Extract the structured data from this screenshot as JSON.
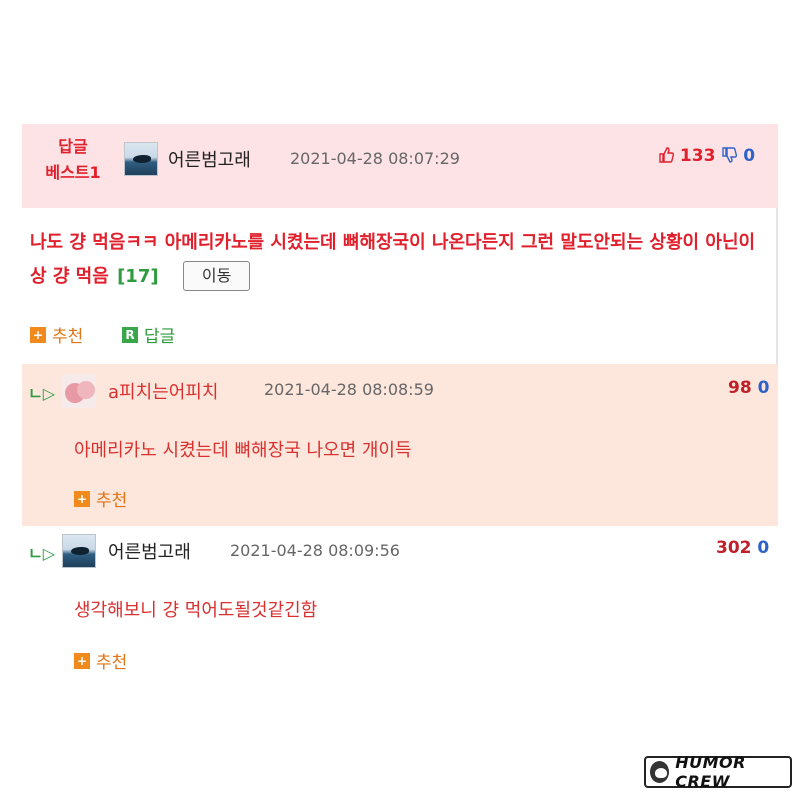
{
  "best": {
    "label_line1": "답글",
    "label_line2": "베스트1",
    "author": "어른범고래",
    "datetime": "2021-04-28 08:07:29",
    "upvotes": "133",
    "downvotes": "0",
    "body": "나도 걍 먹음ㅋㅋ 아메리카노를 시켰는데 뼈해장국이 나온다든지 그런 말도안되는 상황이 아닌이상 걍 먹음",
    "reply_count": "[17]",
    "move_label": "이동",
    "recommend_label": "추천",
    "reply_label": "답글"
  },
  "replies": [
    {
      "author": "a피치는어피치",
      "datetime": "2021-04-28 08:08:59",
      "upvotes": "98",
      "downvotes": "0",
      "body": "아메리카노 시켰는데 뼈해장국 나오면 개이득",
      "recommend_label": "추천"
    },
    {
      "author": "어른범고래",
      "datetime": "2021-04-28 08:09:56",
      "upvotes": "302",
      "downvotes": "0",
      "body": "생각해보니 걍 먹어도될것같긴함",
      "recommend_label": "추천"
    }
  ],
  "icons": {
    "reply_arrow": "ㄴ▷",
    "recommend_icon": "+",
    "reply_icon": "R"
  },
  "watermark": "HUMOR CREW",
  "colors": {
    "best_red": "#e0202c",
    "best_header_bg": "#fde3e6",
    "reply1_bg": "#fde7dc",
    "recommend_orange": "#f08a1c",
    "reply_green": "#3aa64a",
    "downvote_blue": "#2f62c8"
  }
}
